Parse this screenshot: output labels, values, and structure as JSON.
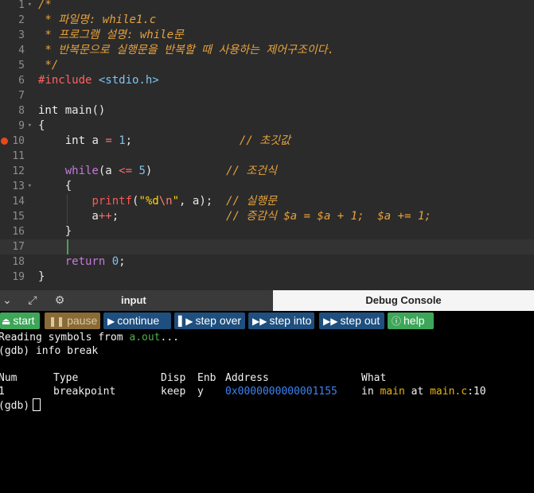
{
  "editor": {
    "lines": [
      {
        "n": "1",
        "fold": true,
        "tokens": [
          [
            "comment",
            "/*"
          ]
        ]
      },
      {
        "n": "2",
        "tokens": [
          [
            "comment",
            " * 파일명: while1.c"
          ]
        ]
      },
      {
        "n": "3",
        "tokens": [
          [
            "comment",
            " * 프로그램 설명: while문"
          ]
        ]
      },
      {
        "n": "4",
        "tokens": [
          [
            "comment",
            " * 반복문으로 실행문을 반복할 때 사용하는 제어구조이다."
          ]
        ]
      },
      {
        "n": "5",
        "tokens": [
          [
            "comment",
            " */"
          ]
        ]
      },
      {
        "n": "6",
        "tokens": [
          [
            "pp",
            "#include "
          ],
          [
            "inc",
            "<stdio.h>"
          ]
        ]
      },
      {
        "n": "7",
        "tokens": []
      },
      {
        "n": "8",
        "tokens": [
          [
            "type",
            "int"
          ],
          [
            "plain",
            " main()"
          ]
        ]
      },
      {
        "n": "9",
        "fold": true,
        "tokens": [
          [
            "plain",
            "{"
          ]
        ]
      },
      {
        "n": "10",
        "breakpoint": true,
        "tokens": [
          [
            "plain",
            "    "
          ],
          [
            "type",
            "int"
          ],
          [
            "plain",
            " a "
          ],
          [
            "op",
            "="
          ],
          [
            "plain",
            " "
          ],
          [
            "num",
            "1"
          ],
          [
            "plain",
            ";                "
          ],
          [
            "comment",
            "// 초깃값"
          ]
        ]
      },
      {
        "n": "11",
        "tokens": []
      },
      {
        "n": "12",
        "tokens": [
          [
            "plain",
            "    "
          ],
          [
            "kw",
            "while"
          ],
          [
            "plain",
            "(a "
          ],
          [
            "op",
            "<="
          ],
          [
            "plain",
            " "
          ],
          [
            "num",
            "5"
          ],
          [
            "plain",
            ")           "
          ],
          [
            "comment",
            "// 조건식"
          ]
        ]
      },
      {
        "n": "13",
        "fold": true,
        "tokens": [
          [
            "plain",
            "    {"
          ]
        ]
      },
      {
        "n": "14",
        "tokens": [
          [
            "plain",
            "        "
          ],
          [
            "func",
            "printf"
          ],
          [
            "plain",
            "("
          ],
          [
            "str",
            "\"%d"
          ],
          [
            "esc",
            "\\n"
          ],
          [
            "str",
            "\""
          ],
          [
            "plain",
            ", a);  "
          ],
          [
            "comment",
            "// 실행문"
          ]
        ]
      },
      {
        "n": "15",
        "tokens": [
          [
            "plain",
            "        a"
          ],
          [
            "op",
            "++"
          ],
          [
            "plain",
            ";                "
          ],
          [
            "comment",
            "// 증감식 $a = $a + 1;  $a += 1;"
          ]
        ]
      },
      {
        "n": "16",
        "tokens": [
          [
            "plain",
            "    }"
          ]
        ]
      },
      {
        "n": "17",
        "active": true,
        "tokens": []
      },
      {
        "n": "18",
        "tokens": [
          [
            "plain",
            "    "
          ],
          [
            "kw",
            "return"
          ],
          [
            "plain",
            " "
          ],
          [
            "num",
            "0"
          ],
          [
            "plain",
            ";"
          ]
        ]
      },
      {
        "n": "19",
        "tokens": [
          [
            "plain",
            "}"
          ]
        ]
      }
    ]
  },
  "tabs": {
    "input_label": "input",
    "debug_label": "Debug Console"
  },
  "toolbar": {
    "start": "start",
    "pause": "pause",
    "continue": "continue",
    "step_over": "step over",
    "step_into": "step into",
    "step_out": "step out",
    "help": "help"
  },
  "console": {
    "reading_prefix": "Reading symbols from ",
    "reading_file": "a.out",
    "reading_suffix": "...",
    "cmd_line": "(gdb) info break",
    "headers": {
      "num": "Num",
      "type": "Type",
      "disp": "Disp",
      "enb": "Enb",
      "address": "Address",
      "what": "What"
    },
    "row": {
      "num": "1",
      "type": "breakpoint",
      "disp": "keep",
      "enb": "y",
      "address": "0x0000000000001155",
      "in": "in",
      "func": "main",
      "at": "at",
      "file": "main.c",
      "line": ":10"
    },
    "prompt": "(gdb)"
  }
}
